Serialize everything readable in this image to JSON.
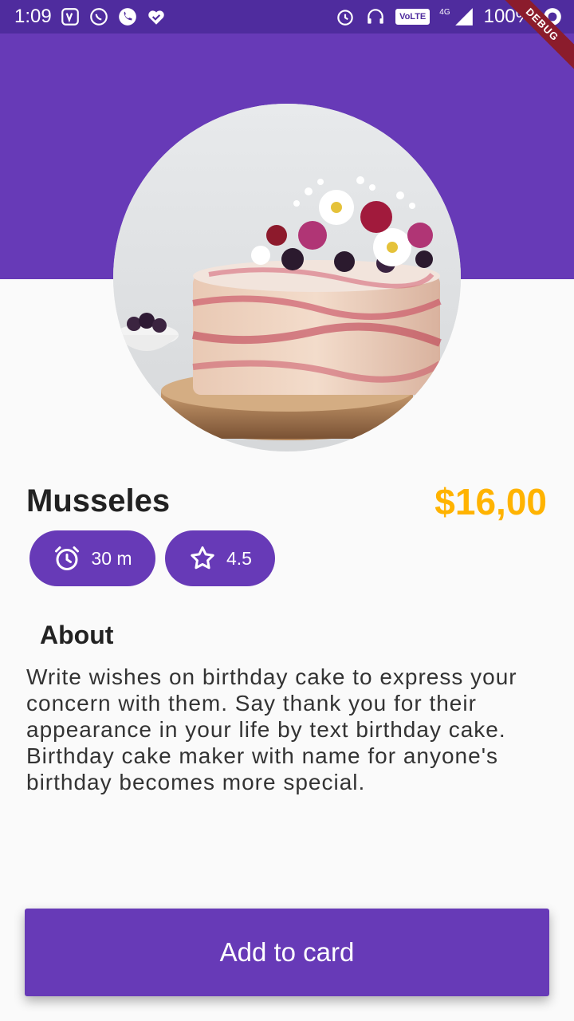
{
  "status_bar": {
    "time": "1:09",
    "battery": "100%",
    "network": "4G",
    "volte": "VoLTE",
    "left_icons": [
      "jiosaavn-icon",
      "whatsapp-icon",
      "phone-icon",
      "heart-check-icon"
    ],
    "right_icons": [
      "alarm-icon",
      "headset-icon",
      "volte-icon",
      "signal-icon",
      "record-icon"
    ]
  },
  "debug_banner": "DEBUG",
  "product": {
    "name": "Musseles",
    "price": "$16,00",
    "image_subject": "cake-image"
  },
  "chips": {
    "time": {
      "icon": "alarm-icon",
      "label": "30 m"
    },
    "rating": {
      "icon": "star-outline-icon",
      "label": "4.5"
    }
  },
  "about": {
    "heading": "About",
    "text": "Write wishes on birthday cake to express your concern with them. Say thank you for their appearance in your life by text birthday cake. Birthday cake maker with name for anyone's birthday becomes more special."
  },
  "cta": {
    "label": "Add to card"
  },
  "colors": {
    "primary": "#673ab7",
    "status_bar": "#4f2c9e",
    "price": "#ffb300",
    "background": "#fafafa"
  }
}
